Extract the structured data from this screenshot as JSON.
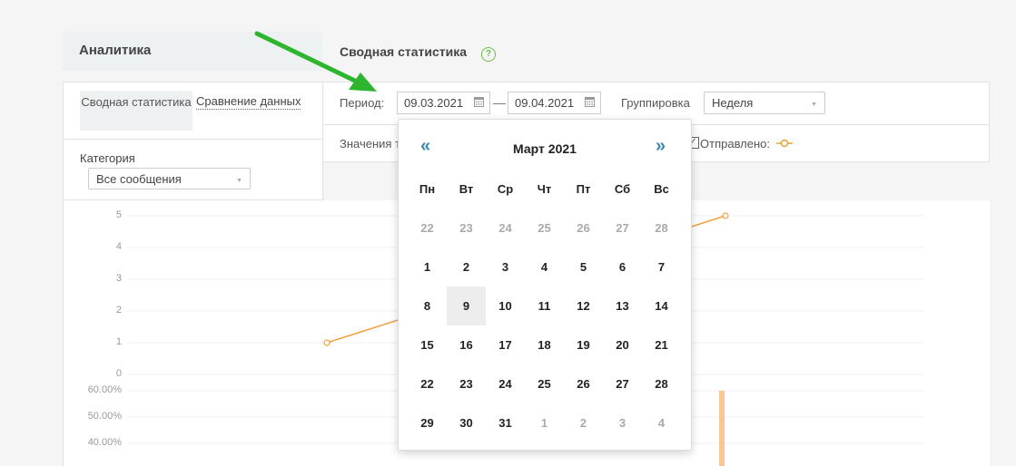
{
  "sidebar": {
    "title": "Аналитика",
    "tabs": [
      {
        "label": "Сводная статистика",
        "active": true
      },
      {
        "label": "Сравнение данных",
        "active": false
      }
    ],
    "category": {
      "label": "Категория",
      "value": "Все сообщения"
    }
  },
  "main": {
    "title": "Сводная статистика",
    "help": "?",
    "filters": {
      "period_label": "Период:",
      "date_from": "09.03.2021",
      "date_to": "09.04.2021",
      "separator": "—",
      "grouping_label": "Группировка",
      "grouping_value": "Неделя"
    },
    "values": {
      "label": "Значения т",
      "sent_checked": true,
      "sent_label": "Отправлено:"
    }
  },
  "chart_data": [
    {
      "type": "line",
      "yticks": [
        "5",
        "4",
        "3",
        "2",
        "1",
        "0"
      ],
      "ylim": [
        0,
        5
      ],
      "series": [
        {
          "color": "#f0a040",
          "points": [
            [
              1,
              1
            ],
            [
              2,
              5
            ]
          ]
        }
      ]
    },
    {
      "type": "bar",
      "yticks": [
        "60.00%",
        "50.00%",
        "40.00%"
      ],
      "series": [
        {
          "color": "#f9c890",
          "values": [
            60
          ]
        }
      ]
    }
  ],
  "calendar": {
    "prev": "«",
    "next": "»",
    "month": "Март 2021",
    "weekdays": [
      "Пн",
      "Вт",
      "Ср",
      "Чт",
      "Пт",
      "Сб",
      "Вс"
    ],
    "weeks": [
      [
        {
          "d": "22",
          "m": true
        },
        {
          "d": "23",
          "m": true
        },
        {
          "d": "24",
          "m": true
        },
        {
          "d": "25",
          "m": true
        },
        {
          "d": "26",
          "m": true
        },
        {
          "d": "27",
          "m": true
        },
        {
          "d": "28",
          "m": true
        }
      ],
      [
        {
          "d": "1"
        },
        {
          "d": "2"
        },
        {
          "d": "3"
        },
        {
          "d": "4"
        },
        {
          "d": "5"
        },
        {
          "d": "6"
        },
        {
          "d": "7"
        }
      ],
      [
        {
          "d": "8"
        },
        {
          "d": "9",
          "sel": true
        },
        {
          "d": "10"
        },
        {
          "d": "11"
        },
        {
          "d": "12"
        },
        {
          "d": "13"
        },
        {
          "d": "14"
        }
      ],
      [
        {
          "d": "15"
        },
        {
          "d": "16"
        },
        {
          "d": "17"
        },
        {
          "d": "18"
        },
        {
          "d": "19"
        },
        {
          "d": "20"
        },
        {
          "d": "21"
        }
      ],
      [
        {
          "d": "22"
        },
        {
          "d": "23"
        },
        {
          "d": "24"
        },
        {
          "d": "25"
        },
        {
          "d": "26"
        },
        {
          "d": "27"
        },
        {
          "d": "28"
        }
      ],
      [
        {
          "d": "29"
        },
        {
          "d": "30"
        },
        {
          "d": "31"
        },
        {
          "d": "1",
          "m": true
        },
        {
          "d": "2",
          "m": true
        },
        {
          "d": "3",
          "m": true
        },
        {
          "d": "4",
          "m": true
        }
      ]
    ]
  },
  "colors": {
    "accent": "#3a87ad",
    "arrow": "#2db52d",
    "line": "#f0a040"
  }
}
